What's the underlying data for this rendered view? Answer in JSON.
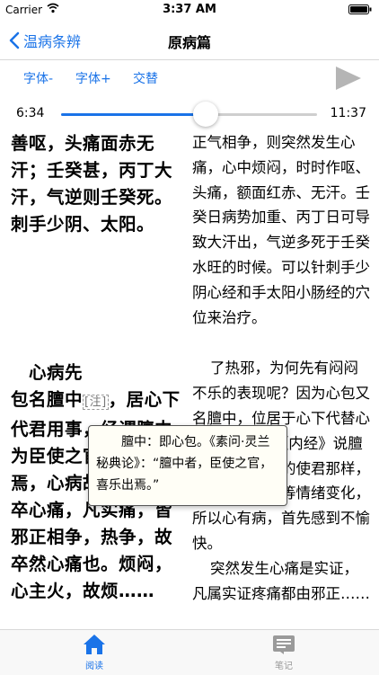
{
  "status": {
    "carrier": "Carrier",
    "time": "3:37 AM"
  },
  "nav": {
    "back_label": "温病条辨",
    "title": "原病篇"
  },
  "toolbar": {
    "font_minus": "字体-",
    "font_plus": "字体+",
    "alternate": "交替"
  },
  "player": {
    "current": "6:34",
    "total": "11:37",
    "progress": 0.565
  },
  "content": {
    "left_para1": "善呕，头痛面赤无汗；壬癸甚，丙丁大汗，气逆则壬癸死。刺手少阴、太阳。",
    "left_para2_a": "心病先",
    "left_para2_b": "包名膻中",
    "note_tag": "[注]",
    "left_para2_c": "，居心下代君用事，经谓膻中为臣使之官，喜乐出焉，心病故不乐也。卒心痛，凡实痛，皆邪正相争，热争，故卒然心痛也。烦闷，心主火，故烦……",
    "right_text": "正气相争，则突然发生心痛，心中烦闷，时时作呕、头痛，额面红赤、无汗。壬癸日病势加重、丙丁日可导致大汗出，气逆多死于壬癸水旺的时候。可以针刺手少阴心经和手太阳小肠经的穴位来治疗。",
    "right_text2": "了热邪，为何先有闷闷不乐的表现呢？因为心包又名膻中，位居于心下代替心脏行使功能，《内经》说膻中就好象君主的使君那样，主管喜怒哀乐等情绪变化，所以心有病，首先感到不愉快。",
    "right_text3": "突然发生心痛是实证，凡属实证疼痛都由邪正……"
  },
  "popup": {
    "text": "膻中：即心包。《素问·灵兰秘典论》：“膻中者，臣使之官，喜乐出焉。”"
  },
  "tabs": [
    {
      "label": "阅读"
    },
    {
      "label": "笔记"
    }
  ],
  "colors": {
    "accent": "#1a73e8",
    "inactive": "#999999"
  }
}
